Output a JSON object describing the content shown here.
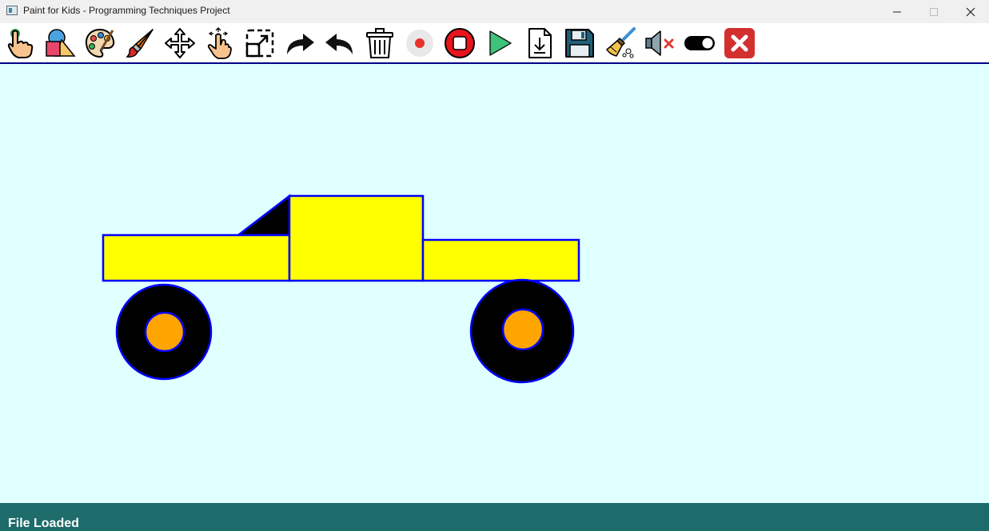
{
  "window": {
    "title": "Paint for Kids - Programming Techniques Project"
  },
  "toolbar": {
    "tools": [
      {
        "icon": "select-hand-icon"
      },
      {
        "icon": "shapes-icon"
      },
      {
        "icon": "color-palette-icon"
      },
      {
        "icon": "paint-brush-icon"
      },
      {
        "icon": "move-arrows-icon"
      },
      {
        "icon": "drag-hand-icon"
      },
      {
        "icon": "resize-icon"
      },
      {
        "icon": "redo-icon"
      },
      {
        "icon": "undo-icon"
      },
      {
        "icon": "trash-icon"
      },
      {
        "icon": "record-icon"
      },
      {
        "icon": "stop-icon"
      },
      {
        "icon": "play-icon"
      },
      {
        "icon": "load-file-icon"
      },
      {
        "icon": "save-icon"
      },
      {
        "icon": "clear-broom-icon"
      },
      {
        "icon": "mute-icon"
      },
      {
        "icon": "toggle-icon"
      },
      {
        "icon": "exit-icon"
      }
    ]
  },
  "canvas": {
    "background": "#e0ffff",
    "drawing": "pickup truck",
    "fill_color": "#ffff00",
    "border_color": "#0000ff",
    "wheel_color": "#000000",
    "hub_color": "#ffa500"
  },
  "status": {
    "text": "File Loaded"
  }
}
